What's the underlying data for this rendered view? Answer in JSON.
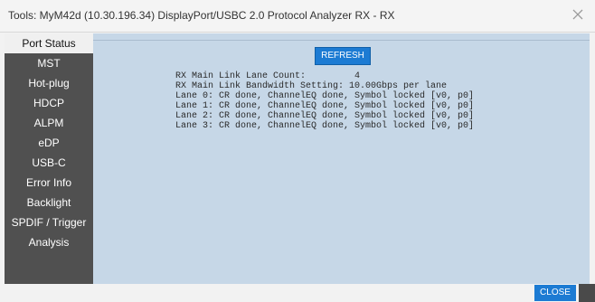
{
  "window": {
    "title": "Tools: MyM42d (10.30.196.34) DisplayPort/USBC 2.0 Protocol Analyzer RX - RX",
    "close_icon": "close-icon"
  },
  "sidebar": {
    "items": [
      {
        "label": "Port Status",
        "active": true
      },
      {
        "label": "MST"
      },
      {
        "label": "Hot-plug"
      },
      {
        "label": "HDCP"
      },
      {
        "label": "ALPM"
      },
      {
        "label": "eDP"
      },
      {
        "label": "USB-C"
      },
      {
        "label": "Error Info"
      },
      {
        "label": "Backlight"
      },
      {
        "label": "SPDIF / Trigger"
      },
      {
        "label": "Analysis"
      }
    ]
  },
  "main": {
    "refresh_label": "REFRESH",
    "status_lines": [
      "RX Main Link Lane Count:         4",
      "RX Main Link Bandwidth Setting: 10.00Gbps per lane",
      "Lane 0: CR done, ChannelEQ done, Symbol locked [v0, p0]",
      "Lane 1: CR done, ChannelEQ done, Symbol locked [v0, p0]",
      "Lane 2: CR done, ChannelEQ done, Symbol locked [v0, p0]",
      "Lane 3: CR done, ChannelEQ done, Symbol locked [v0, p0]"
    ]
  },
  "footer": {
    "close_label": "CLOSE"
  },
  "colors": {
    "accent": "#1c7bd3",
    "sidebar_bg": "#505050",
    "content_bg": "#c6d7e7"
  }
}
